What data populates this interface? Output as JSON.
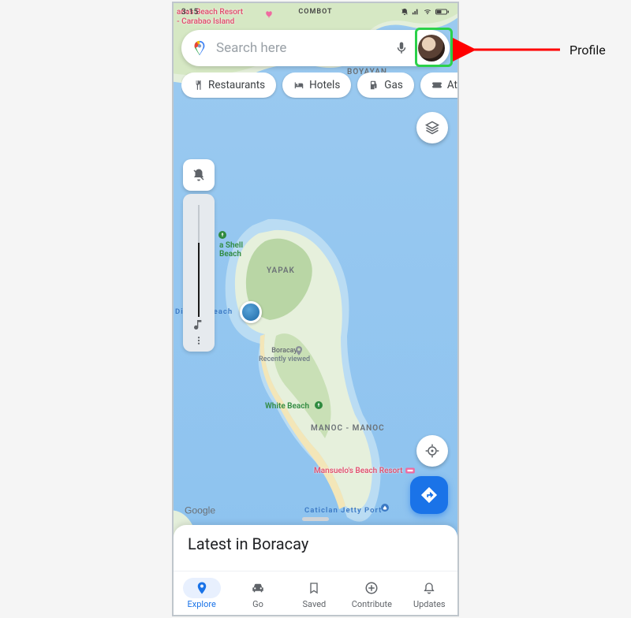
{
  "status_bar": {
    "time": "3:15",
    "carrier": "COMBOT"
  },
  "search": {
    "placeholder": "Search here"
  },
  "chips": [
    {
      "icon": "restaurant",
      "label": "Restaurants"
    },
    {
      "icon": "hotel",
      "label": "Hotels"
    },
    {
      "icon": "gas",
      "label": "Gas"
    },
    {
      "icon": "ticket",
      "label": "Attrac"
    }
  ],
  "map_labels": {
    "top_resort": "anas Beach Resort",
    "top_island": "- Carabao Island",
    "region": "BOYAYAN",
    "yapak": "YAPAK",
    "shell_beach_1": "a Shell",
    "shell_beach_2": "Beach",
    "diniwid": "Diniwid Beach",
    "boracay": "Boracay",
    "recently_viewed": "Recently viewed",
    "white_beach": "White Beach",
    "manoc": "MANOC - MANOC",
    "mansuelo": "Mansuelo's Beach Resort",
    "caticlan": "Caticlan Jetty Port",
    "google": "Google"
  },
  "bottom_card": {
    "title": "Latest in Boracay"
  },
  "bottom_nav": [
    {
      "key": "explore",
      "label": "Explore",
      "active": true
    },
    {
      "key": "go",
      "label": "Go",
      "active": false
    },
    {
      "key": "saved",
      "label": "Saved",
      "active": false
    },
    {
      "key": "contribute",
      "label": "Contribute",
      "active": false
    },
    {
      "key": "updates",
      "label": "Updates",
      "active": false
    }
  ],
  "annotation": {
    "label": "Profile"
  },
  "colors": {
    "accent": "#1a73e8",
    "highlight": "#2bd14a",
    "arrow": "#ff0000"
  }
}
